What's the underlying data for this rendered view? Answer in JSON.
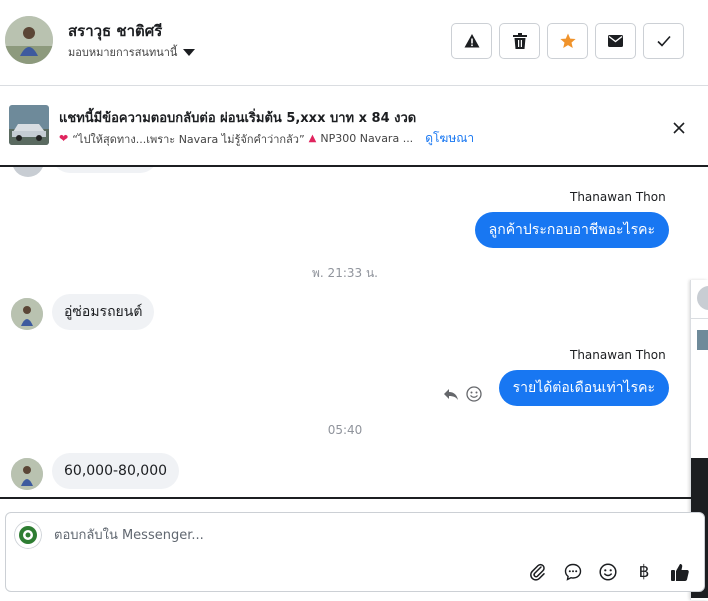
{
  "header": {
    "contact_name": "สราวุธ ชาติศรี",
    "assign_label": "มอบหมายการสนทนานี้",
    "actions": [
      {
        "name": "report-button",
        "icon": "warning-icon"
      },
      {
        "name": "delete-button",
        "icon": "trash-icon"
      },
      {
        "name": "star-button",
        "icon": "star-icon",
        "color": "#f0932b"
      },
      {
        "name": "mark-unread-button",
        "icon": "envelope-icon"
      },
      {
        "name": "mark-done-button",
        "icon": "check-icon"
      }
    ]
  },
  "ad": {
    "title": "แชทนี้มีข้อความตอบกลับต่อ ผ่อนเริ่มต้น 5,xxx บาท x 84 งวด",
    "subtitle": "“ไปให้สุดทาง...เพราะ Navara ไม่รู้จักคำว่ากลัว”",
    "subtitle_tail": "NP300 Navara ...",
    "link": "ดูโฆษณา"
  },
  "messages": {
    "sender_1": "Thanawan Thon",
    "out_1": "ลูกค้าประกอบอาชีพอะไรคะ",
    "time_1": "พ. 21:33 น.",
    "in_1": "อู่ซ่อมรถยนต์",
    "sender_2": "Thanawan Thon",
    "out_2": "รายได้ต่อเดือนเท่าไรคะ",
    "time_2": "05:40",
    "in_2": "60,000-80,000"
  },
  "composer": {
    "placeholder": "ตอบกลับใน Messenger..."
  },
  "colors": {
    "accent": "#1877f2",
    "star": "#f0932b",
    "incoming_bubble": "#f0f2f5"
  }
}
